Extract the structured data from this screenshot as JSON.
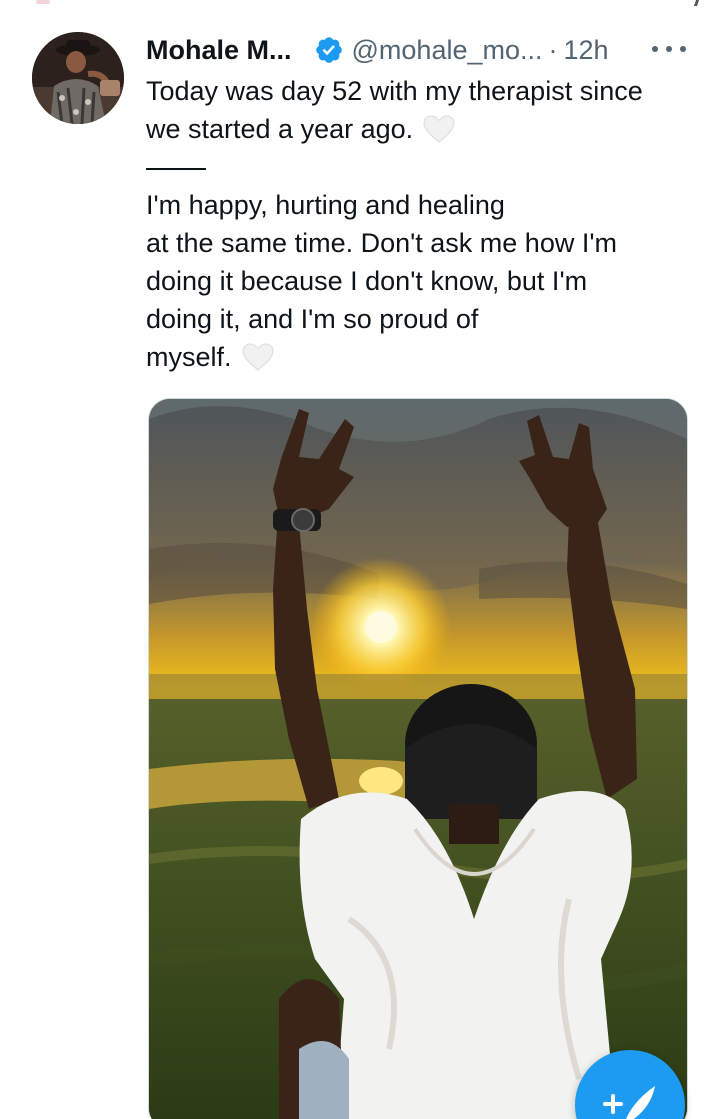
{
  "tweet": {
    "display_name": "Mohale M...",
    "handle": "@mohale_mo...",
    "separator": "·",
    "time": "12h",
    "text_lines": [
      "Today was day 52 with my therapist since",
      "we started a year ago.",
      "I'm happy, hurting and healing",
      "at the same time. Don't ask me how I'm",
      "doing it because I don't know, but I'm",
      "doing it, and I'm so proud of",
      "myself."
    ],
    "emoji": "white-heart",
    "verified": true
  },
  "media": {
    "description_icon": "photo"
  },
  "colors": {
    "verified": "#1d9bf0",
    "secondary_text": "#536471",
    "compose_fab": "#1d9bf0"
  },
  "icons": {
    "verified": "verified-badge-icon",
    "more": "more-options-icon",
    "heart": "white-heart-icon",
    "compose": "compose-tweet-icon"
  }
}
